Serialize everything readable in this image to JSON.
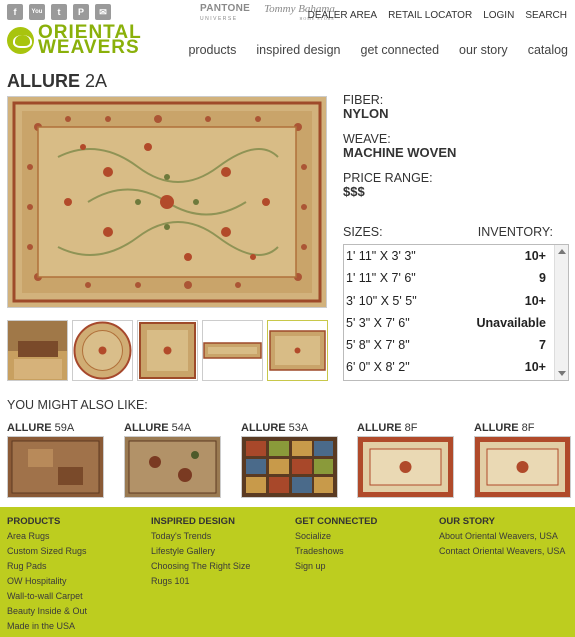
{
  "social": {
    "icons": [
      "facebook-icon",
      "youtube-icon",
      "twitter-icon",
      "pinterest-icon",
      "email-icon"
    ],
    "glyphs": [
      "f",
      "You",
      "t",
      "P",
      "✉"
    ]
  },
  "partners": {
    "pantone": "PANTONE",
    "pantone_sub": "UNIVERSE",
    "tommy": "Tommy Bahama",
    "tommy_sub": "HOME STORE"
  },
  "utility_nav": [
    "DEALER AREA",
    "RETAIL LOCATOR",
    "LOGIN",
    "SEARCH"
  ],
  "logo": {
    "line1": "ORIENTAL",
    "line2": "WEAVERS"
  },
  "main_nav": [
    "products",
    "inspired design",
    "get connected",
    "our story",
    "catalog"
  ],
  "product": {
    "name": "ALLURE",
    "code": "2A",
    "fiber_label": "FIBER:",
    "fiber": "NYLON",
    "weave_label": "WEAVE:",
    "weave": "MACHINE WOVEN",
    "price_label": "PRICE RANGE:",
    "price": "$$$",
    "sizes_label": "SIZES:",
    "inventory_label": "INVENTORY:",
    "sizes": [
      {
        "size": "1' 11\" X 3' 3\"",
        "inventory": "10+"
      },
      {
        "size": "1' 11\" X 7' 6\"",
        "inventory": "9"
      },
      {
        "size": "3' 10\" X 5' 5\"",
        "inventory": "10+"
      },
      {
        "size": "5' 3\" X 7' 6\"",
        "inventory": "Unavailable"
      },
      {
        "size": "5' 8\" X 7' 8\"",
        "inventory": "7"
      },
      {
        "size": "6' 0\" X 8' 2\"",
        "inventory": "10+"
      }
    ]
  },
  "also_like": {
    "heading": "YOU MIGHT ALSO LIKE:",
    "items": [
      {
        "name": "ALLURE",
        "code": "59A"
      },
      {
        "name": "ALLURE",
        "code": "54A"
      },
      {
        "name": "ALLURE",
        "code": "53A"
      },
      {
        "name": "ALLURE",
        "code": "8F"
      },
      {
        "name": "ALLURE",
        "code": "8F"
      }
    ]
  },
  "footer": {
    "columns": [
      {
        "heading": "PRODUCTS",
        "links": [
          "Area Rugs",
          "Custom Sized Rugs",
          "Rug Pads",
          "OW Hospitality",
          "Wall-to-wall Carpet",
          "Beauty Inside & Out",
          "Made in the USA"
        ]
      },
      {
        "heading": "INSPIRED DESIGN",
        "links": [
          "Today's Trends",
          "Lifestyle Gallery",
          "Choosing The Right Size",
          "Rugs 101"
        ]
      },
      {
        "heading": "GET CONNECTED",
        "links": [
          "Socialize",
          "Tradeshows",
          "Sign up"
        ]
      },
      {
        "heading": "OUR STORY",
        "links": [
          "About Oriental Weavers, USA",
          "Contact Oriental Weavers, USA"
        ]
      }
    ]
  },
  "colors": {
    "brand_green": "#a8c40e",
    "footer_bg": "#bdcd1f",
    "rug_beige": "#d9be8a",
    "rug_red": "#b24a2a"
  }
}
